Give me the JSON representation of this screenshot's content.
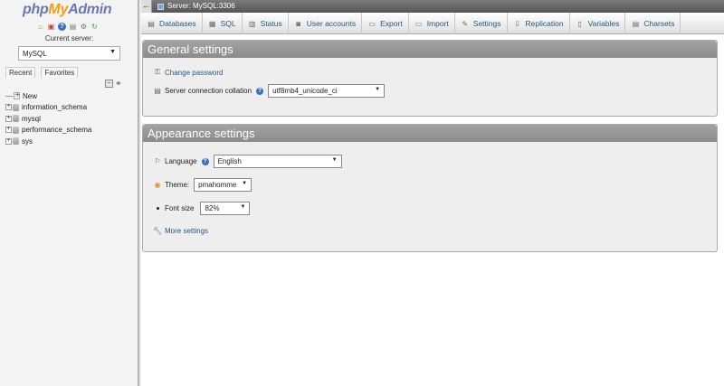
{
  "nav": {
    "logo": {
      "php": "php",
      "my": "My",
      "admin": "Admin"
    },
    "icons": [
      "home-icon",
      "exit-icon",
      "help-icon",
      "docs-icon",
      "settings-icon",
      "reload-icon"
    ],
    "current_server_label": "Current server:",
    "server_select_value": "MySQL",
    "tabs": {
      "recent": "Recent",
      "favorites": "Favorites"
    },
    "tree": [
      {
        "label": "New"
      },
      {
        "label": "information_schema"
      },
      {
        "label": "mysql"
      },
      {
        "label": "performance_schema"
      },
      {
        "label": "sys"
      }
    ]
  },
  "topbar": {
    "breadcrumb": "Server: MySQL:3306"
  },
  "menu": [
    {
      "label": "Databases",
      "icon": "databases-icon"
    },
    {
      "label": "SQL",
      "icon": "sql-icon"
    },
    {
      "label": "Status",
      "icon": "status-icon"
    },
    {
      "label": "User accounts",
      "icon": "user-accounts-icon"
    },
    {
      "label": "Export",
      "icon": "export-icon"
    },
    {
      "label": "Import",
      "icon": "import-icon"
    },
    {
      "label": "Settings",
      "icon": "settings-icon"
    },
    {
      "label": "Replication",
      "icon": "replication-icon"
    },
    {
      "label": "Variables",
      "icon": "variables-icon"
    },
    {
      "label": "Charsets",
      "icon": "charsets-icon"
    }
  ],
  "general": {
    "title": "General settings",
    "change_password": "Change password",
    "collation_label": "Server connection collation",
    "collation_value": "utf8mb4_unicode_ci"
  },
  "appearance": {
    "title": "Appearance settings",
    "language_label": "Language",
    "language_value": "English",
    "theme_label": "Theme:",
    "theme_value": "pmahomme",
    "font_size_label": "Font size",
    "font_size_value": "82%",
    "more_settings": "More settings"
  },
  "colors": {
    "link": "#235a81",
    "header_bg": "#999999",
    "logo_blue": "#6c78af",
    "logo_orange": "#f89c0e"
  }
}
